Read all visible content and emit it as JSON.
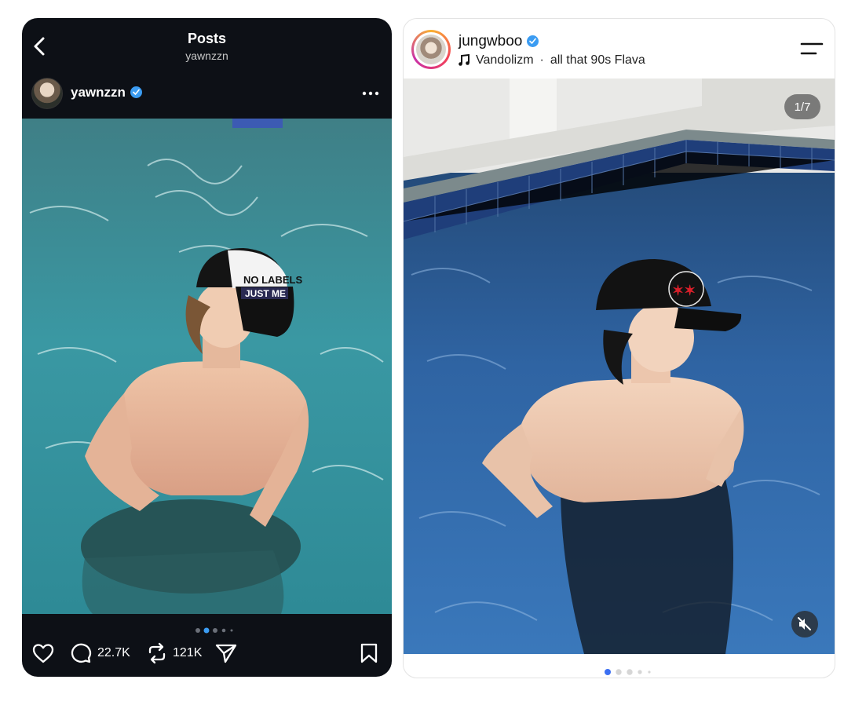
{
  "left_post": {
    "header_title": "Posts",
    "header_subtitle": "yawnzzn",
    "username": "yawnzzn",
    "verified": true,
    "cap_text_line1": "NO LABELS",
    "cap_text_line2": "JUST ME",
    "carousel_dots": 5,
    "carousel_active_index": 1,
    "comments_count": "22.7K",
    "reposts_count": "121K",
    "colors": {
      "background": "#0d1016",
      "verified": "#3b9cf2"
    }
  },
  "right_post": {
    "username": "jungwboo",
    "verified": true,
    "song_artist": "Vandolizm",
    "song_separator": "·",
    "song_title": "all that 90s Flava",
    "counter": "1/7",
    "carousel_dots": 5,
    "carousel_active_index": 0,
    "colors": {
      "active_dot": "#3b6ff2",
      "verified": "#3b9cf2"
    }
  }
}
